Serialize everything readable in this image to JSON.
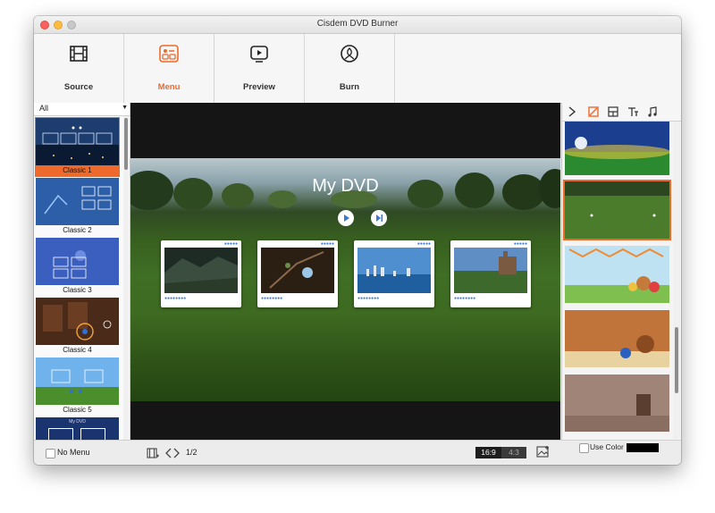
{
  "window": {
    "title": "Cisdem DVD Burner"
  },
  "toolbar": {
    "items": [
      {
        "label": "Source",
        "icon": "film-icon",
        "active": false
      },
      {
        "label": "Menu",
        "icon": "menu-icon",
        "active": true
      },
      {
        "label": "Preview",
        "icon": "play-icon",
        "active": false
      },
      {
        "label": "Burn",
        "icon": "disc-burn-icon",
        "active": false
      }
    ]
  },
  "left_panel": {
    "filter": "All",
    "templates": [
      {
        "label": "Classic 1",
        "selected": true
      },
      {
        "label": "Classic 2",
        "selected": false
      },
      {
        "label": "Classic 3",
        "selected": false
      },
      {
        "label": "Classic 4",
        "selected": false
      },
      {
        "label": "Classic 5",
        "selected": false
      },
      {
        "label": "My DVD",
        "selected": false
      }
    ]
  },
  "preview": {
    "title": "My DVD"
  },
  "right_panel": {
    "tabs": [
      "edit-background-icon",
      "layout-icon",
      "text-icon",
      "music-icon"
    ],
    "use_color_label": "Use Color",
    "color": "#000000"
  },
  "bottom_bar": {
    "no_menu_label": "No Menu",
    "page_indicator": "1/2",
    "ratio_16_9": "16:9",
    "ratio_4_3": "4:3"
  },
  "colors": {
    "accent": "#ee6a2c"
  }
}
